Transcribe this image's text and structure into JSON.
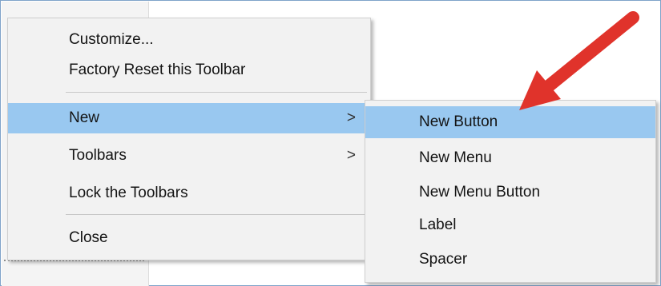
{
  "context_menu": {
    "items": [
      {
        "label": "Customize..."
      },
      {
        "label": "Factory Reset this Toolbar"
      },
      {
        "label": "New",
        "chevron": ">"
      },
      {
        "label": "Toolbars",
        "chevron": ">"
      },
      {
        "label": "Lock the Toolbars"
      },
      {
        "label": "Close"
      }
    ],
    "highlight_color": "#99c8f0"
  },
  "submenu": {
    "items": [
      {
        "label": "New Button"
      },
      {
        "label": "New Menu"
      },
      {
        "label": "New Menu Button"
      },
      {
        "label": "Label"
      },
      {
        "label": "Spacer"
      }
    ]
  },
  "annotation": {
    "arrow_color": "#e0332b"
  }
}
